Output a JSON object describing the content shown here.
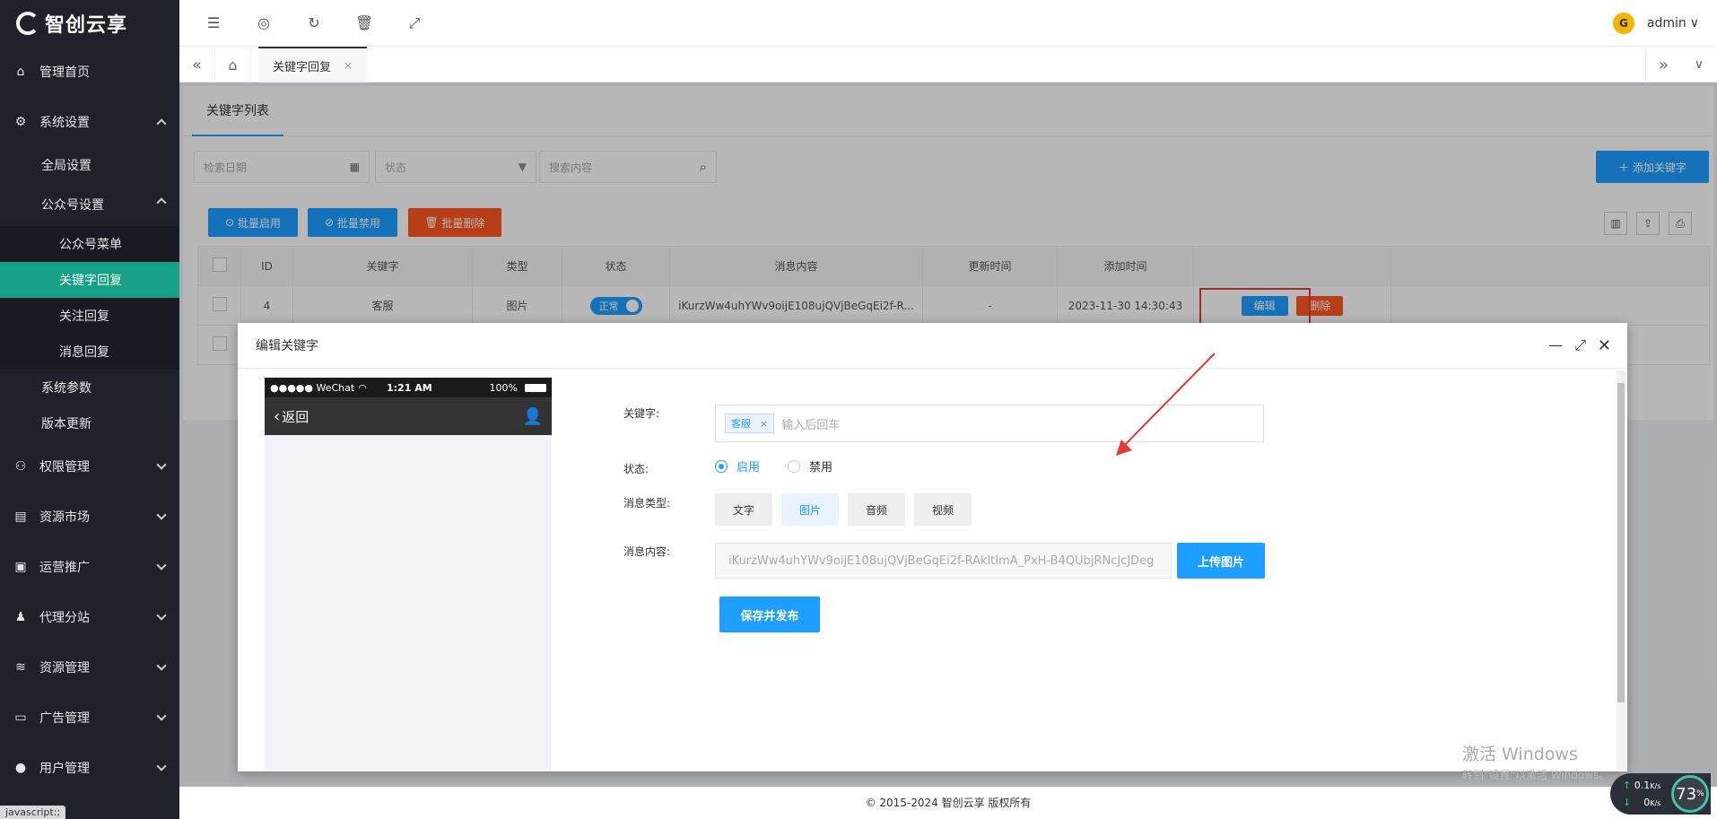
{
  "brand": {
    "name": "智创云享"
  },
  "sidebar": {
    "home": "管理首页",
    "system": "系统设置",
    "global": "全局设置",
    "mp": "公众号设置",
    "mp_items": [
      "公众号菜单",
      "关键字回复",
      "关注回复",
      "消息回复"
    ],
    "params": "系统参数",
    "update": "版本更新",
    "groups": [
      "权限管理",
      "资源市场",
      "运营推广",
      "代理分站",
      "资源管理",
      "广告管理",
      "用户管理"
    ],
    "status_tip": "javascript:;"
  },
  "topbar": {
    "user": "admin"
  },
  "tabs": {
    "active": "关键字回复",
    "close": "×"
  },
  "list": {
    "tab": "关键字列表",
    "date_placeholder": "检索日期",
    "status_placeholder": "状态",
    "search_placeholder": "搜索内容",
    "add_btn": "＋ 添加关键字",
    "batch_enable": "批量启用",
    "batch_disable": "批量禁用",
    "batch_delete": "批量删除",
    "columns": [
      "ID",
      "关键字",
      "类型",
      "状态",
      "消息内容",
      "更新时间",
      "添加时间"
    ],
    "row": {
      "id": "4",
      "keyword": "客服",
      "type": "图片",
      "status": "正常",
      "content": "iKurzWw4uhYWv9oijE108ujQVjBeGqEi2f-R...",
      "updated": "-",
      "added": "2023-11-30 14:30:43",
      "edit": "编辑",
      "delete": "删除"
    }
  },
  "modal": {
    "title": "编辑关键字",
    "phone": {
      "carrier": "●●●●● WeChat",
      "time": "1:21 AM",
      "battery": "100%",
      "back": "返回"
    },
    "keyword_label": "关键字:",
    "keyword_tag": "客服",
    "keyword_placeholder": "输入后回车",
    "status_label": "状态:",
    "status_on": "启用",
    "status_off": "禁用",
    "type_label": "消息类型:",
    "types": [
      "文字",
      "图片",
      "音频",
      "视频"
    ],
    "content_label": "消息内容:",
    "content_value": "iKurzWw4uhYWv9oijE108ujQVjBeGqEi2f-RAkltImA_PxH-B4QUbjRNcJcJDeg",
    "upload": "上传图片",
    "save": "保存并发布"
  },
  "footer": "© 2015-2024 智创云享 版权所有",
  "watermark": {
    "title": "激活 Windows",
    "sub": "转到\"设置\"以激活 Windows。"
  },
  "netmon": {
    "up": "0.1",
    "down": "0",
    "unit": "K/s",
    "percent": "73",
    "pct_sign": "%"
  }
}
